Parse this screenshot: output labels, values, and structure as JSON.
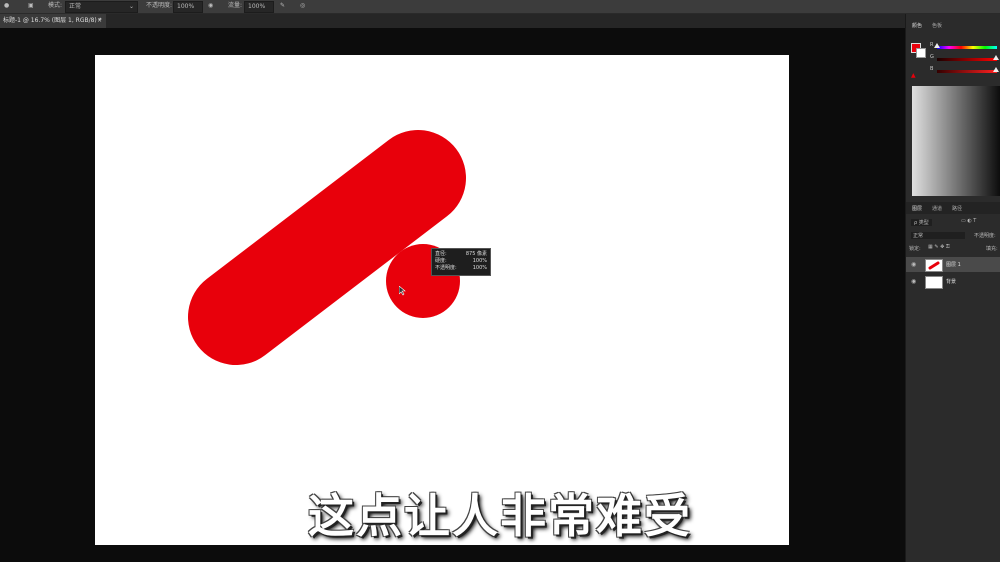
{
  "options_bar": {
    "mode_label": "模式:",
    "mode_value": "正常",
    "opacity_label": "不透明度:",
    "opacity_value": "100%",
    "flow_label": "流量:",
    "flow_value": "100%"
  },
  "document_tab": {
    "title": "标题-1 @ 16.7% (图层 1, RGB/8) *",
    "close": "×"
  },
  "brush_hud": {
    "rows": [
      {
        "label": "直径:",
        "value": "875 像素"
      },
      {
        "label": "硬度:",
        "value": "100%"
      },
      {
        "label": "不透明度:",
        "value": "100%"
      }
    ]
  },
  "subtitle": "这点让人非常难受",
  "panels": {
    "top_tabs": [
      "颜色",
      "色板"
    ],
    "channel_labels": [
      "R",
      "G",
      "B"
    ],
    "layers_tabs": [
      "图层",
      "通道",
      "路径"
    ],
    "kind_label": "ρ 类型",
    "blend_mode": "正常",
    "opacity_label": "不透明度:",
    "lock_label": "锁定:",
    "fill_label": "填充:",
    "layers": [
      {
        "name": "图层 1",
        "selected": true
      },
      {
        "name": "背景",
        "selected": false
      }
    ]
  },
  "colors": {
    "accent_red": "#e8000b",
    "canvas": "#ffffff",
    "workspace": "#0c0c0c"
  }
}
